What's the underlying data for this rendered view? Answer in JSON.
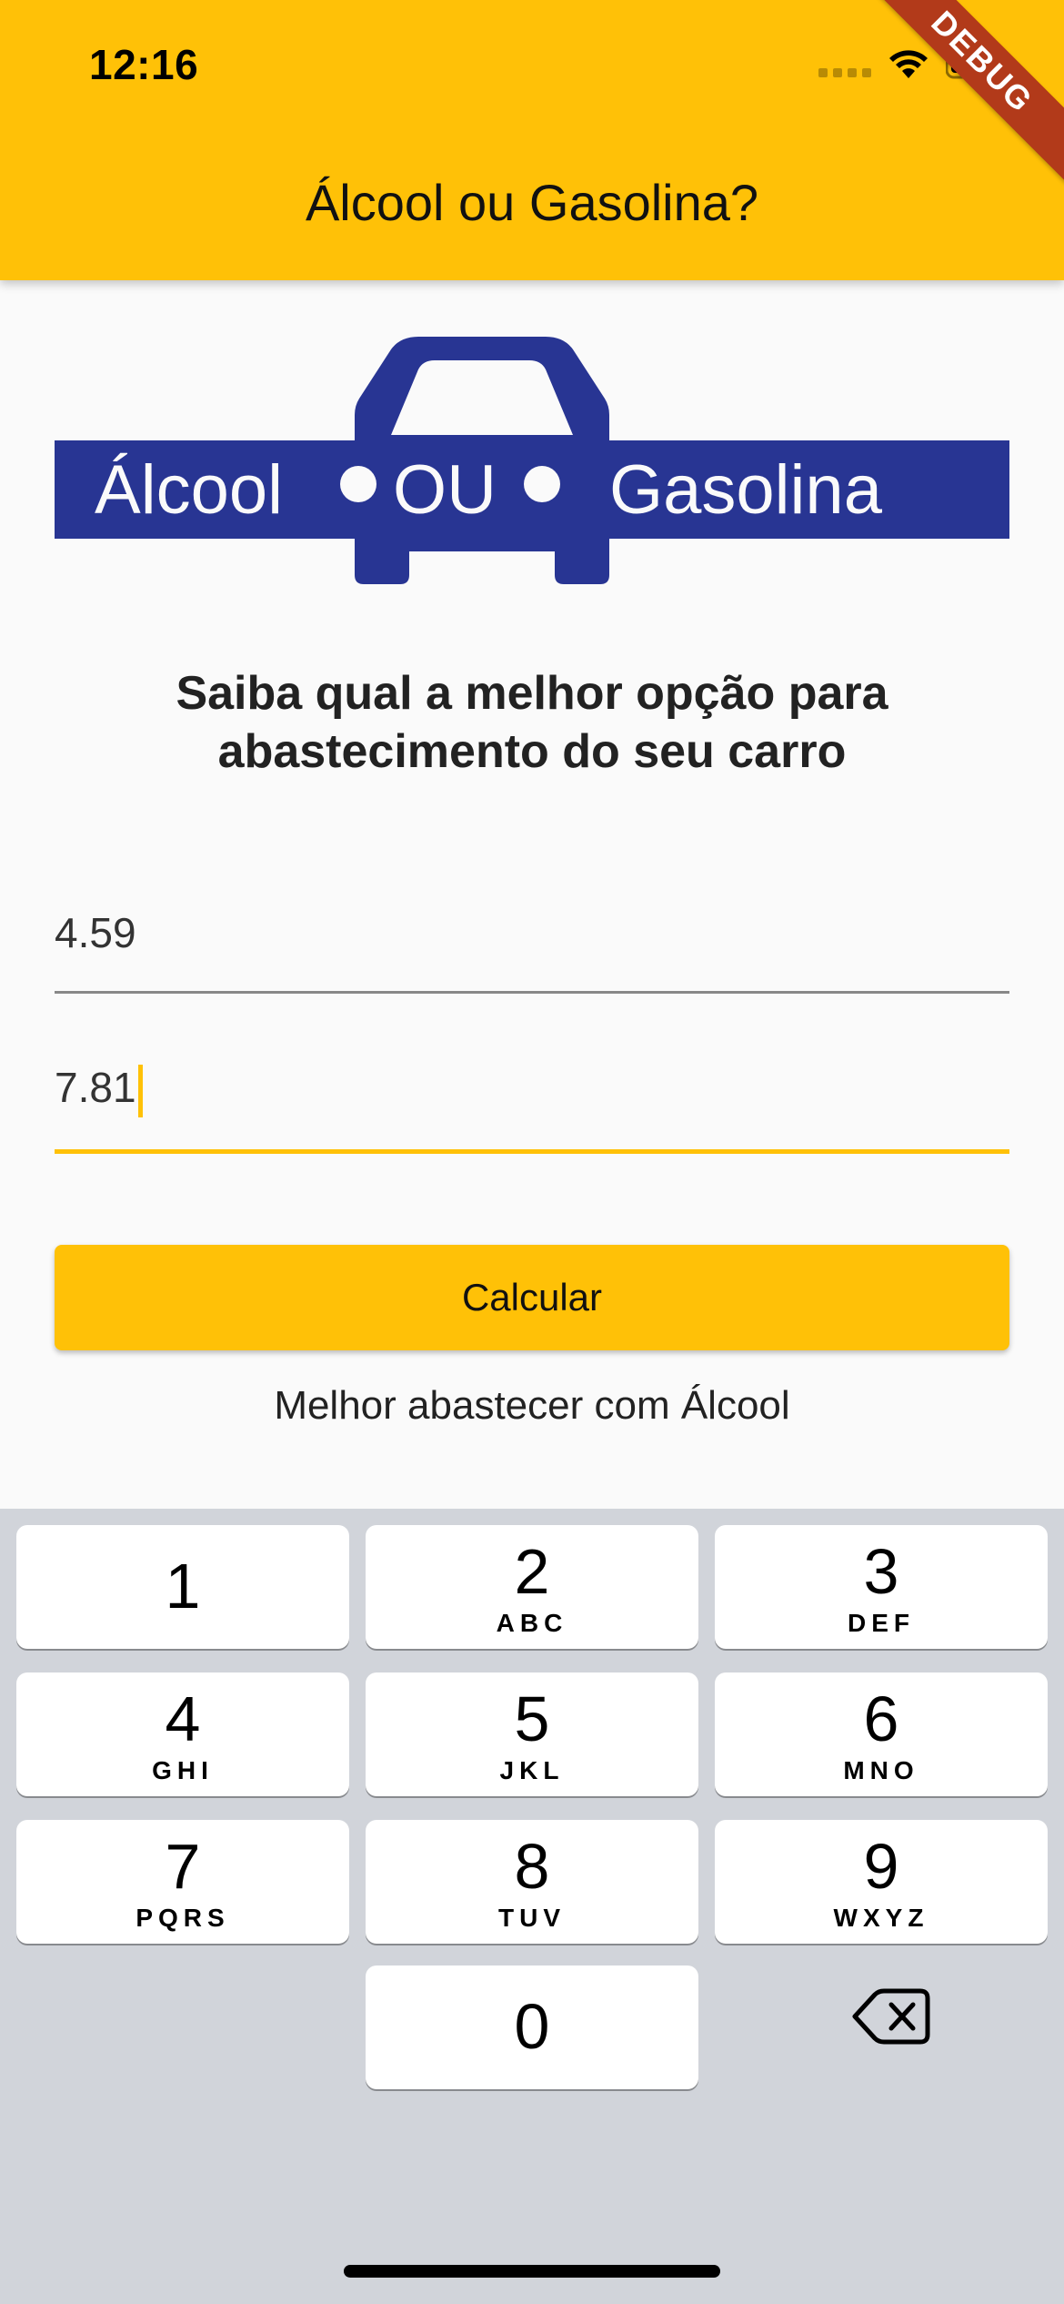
{
  "status_bar": {
    "time": "12:16",
    "icons": [
      "cellular-signal-icon",
      "wifi-icon",
      "battery-icon"
    ]
  },
  "debug_banner": "DEBUG",
  "app_bar": {
    "title": "Álcool ou Gasolina?",
    "background_color": "#FFC107"
  },
  "logo": {
    "text_left": "Álcool",
    "text_middle": "OU",
    "text_right": "Gasolina",
    "color": "#283593"
  },
  "headline": "Saiba qual a melhor opção para abastecimento do seu carro",
  "fields": {
    "alcohol_price": {
      "value": "4.59"
    },
    "gasoline_price": {
      "value": "7.81"
    }
  },
  "calculate_button": {
    "label": "Calcular"
  },
  "result": "Melhor abastecer com Álcool",
  "keyboard": {
    "keys": [
      {
        "digit": "1",
        "letters": ""
      },
      {
        "digit": "2",
        "letters": "ABC"
      },
      {
        "digit": "3",
        "letters": "DEF"
      },
      {
        "digit": "4",
        "letters": "GHI"
      },
      {
        "digit": "5",
        "letters": "JKL"
      },
      {
        "digit": "6",
        "letters": "MNO"
      },
      {
        "digit": "7",
        "letters": "PQRS"
      },
      {
        "digit": "8",
        "letters": "TUV"
      },
      {
        "digit": "9",
        "letters": "WXYZ"
      },
      {
        "digit": "0",
        "letters": ""
      }
    ],
    "delete_icon": "backspace-icon"
  }
}
